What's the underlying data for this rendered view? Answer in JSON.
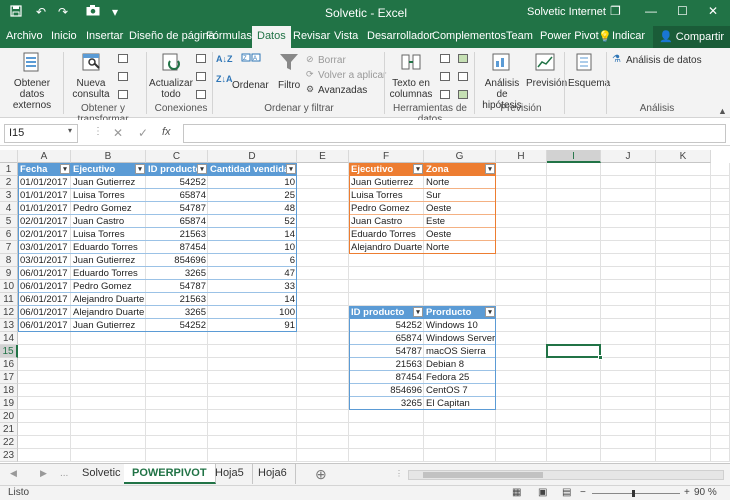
{
  "titlebar": {
    "save_icon": "save-icon",
    "undo": "↶",
    "redo": "↷",
    "camera": "📷",
    "customize": "▾",
    "title": "Solvetic - Excel",
    "user": "Solvetic Internet",
    "restore": "❐",
    "minimize": "—",
    "maximize": "☐",
    "close": "✕"
  },
  "menu": {
    "tabs": [
      "Archivo",
      "Inicio",
      "Insertar",
      "Diseño de página",
      "Fórmulas",
      "Datos",
      "Revisar",
      "Vista",
      "Desarrollador",
      "Complementos",
      "Team",
      "Power Pivot",
      "Indicar"
    ],
    "active": "Datos",
    "share": "Compartir"
  },
  "ribbon": {
    "get_data": "Obtener datos externos",
    "new_query": "Nueva consulta",
    "get_transform_group": "Obtener y transformar",
    "refresh_all": "Actualizar todo",
    "connections_group": "Conexiones",
    "sort": "Ordenar",
    "filter": "Filtro",
    "clear": "Borrar",
    "reapply": "Volver a aplicar",
    "advanced": "Avanzadas",
    "sort_filter_group": "Ordenar y filtrar",
    "text_to_columns": "Texto en columnas",
    "data_tools_group": "Herramientas de datos",
    "what_if": "Análisis de hipótesis",
    "forecast": "Previsión",
    "forecast_group": "Previsión",
    "outline": "Esquema",
    "data_analysis": "Análisis de datos",
    "analysis_group": "Análisis"
  },
  "formula_bar": {
    "name_box": "I15",
    "cancel": "✕",
    "enter": "✓",
    "fx": "fx",
    "value": ""
  },
  "columns": [
    "A",
    "B",
    "C",
    "D",
    "E",
    "F",
    "G",
    "H",
    "I",
    "J",
    "K"
  ],
  "rows": [
    "1",
    "2",
    "3",
    "4",
    "5",
    "6",
    "7",
    "8",
    "9",
    "10",
    "11",
    "12",
    "13",
    "14",
    "15",
    "16",
    "17",
    "18",
    "19",
    "20",
    "21",
    "22",
    "23"
  ],
  "table1": {
    "headers": [
      "Fecha",
      "Ejecutivo",
      "ID producto",
      "Cantidad vendida"
    ],
    "rows": [
      [
        "01/01/2017",
        "Juan Gutierrez",
        "54252",
        "10"
      ],
      [
        "01/01/2017",
        "Luisa Torres",
        "65874",
        "25"
      ],
      [
        "01/01/2017",
        "Pedro Gomez",
        "54787",
        "48"
      ],
      [
        "02/01/2017",
        "Juan Castro",
        "65874",
        "52"
      ],
      [
        "02/01/2017",
        "Luisa Torres",
        "21563",
        "14"
      ],
      [
        "03/01/2017",
        "Eduardo Torres",
        "87454",
        "10"
      ],
      [
        "03/01/2017",
        "Juan Gutierrez",
        "854696",
        "6"
      ],
      [
        "06/01/2017",
        "Eduardo Torres",
        "3265",
        "47"
      ],
      [
        "06/01/2017",
        "Pedro Gomez",
        "54787",
        "33"
      ],
      [
        "06/01/2017",
        "Alejandro Duarte",
        "21563",
        "14"
      ],
      [
        "06/01/2017",
        "Alejandro Duarte",
        "3265",
        "100"
      ],
      [
        "06/01/2017",
        "Juan Gutierrez",
        "54252",
        "91"
      ]
    ]
  },
  "table2": {
    "headers": [
      "Ejecutivo",
      "Zona"
    ],
    "rows": [
      [
        "Juan Gutierrez",
        "Norte"
      ],
      [
        "Luisa Torres",
        "Sur"
      ],
      [
        "Pedro Gomez",
        "Oeste"
      ],
      [
        "Juan Castro",
        "Este"
      ],
      [
        "Eduardo Torres",
        "Oeste"
      ],
      [
        "Alejandro Duarte",
        "Norte"
      ]
    ]
  },
  "table3": {
    "headers": [
      "ID producto",
      "Prorducto"
    ],
    "rows": [
      [
        "54252",
        "Windows 10"
      ],
      [
        "65874",
        "Windows Server"
      ],
      [
        "54787",
        "macOS Sierra"
      ],
      [
        "21563",
        "Debian 8"
      ],
      [
        "87454",
        "Fedora 25"
      ],
      [
        "854696",
        "CentOS 7"
      ],
      [
        "3265",
        "El Capitan"
      ]
    ]
  },
  "sheets": {
    "tabs": [
      "Solvetic",
      "POWERPIVOT",
      "Hoja5",
      "Hoja6"
    ],
    "active": "POWERPIVOT",
    "add": "⊕",
    "prev": "◀",
    "next": "▶",
    "more": "..."
  },
  "status": {
    "ready": "Listo",
    "zoom": "90 %"
  },
  "colors": {
    "excel_green": "#217346",
    "table_blue": "#5b9bd5",
    "table_orange": "#ed7d31"
  }
}
